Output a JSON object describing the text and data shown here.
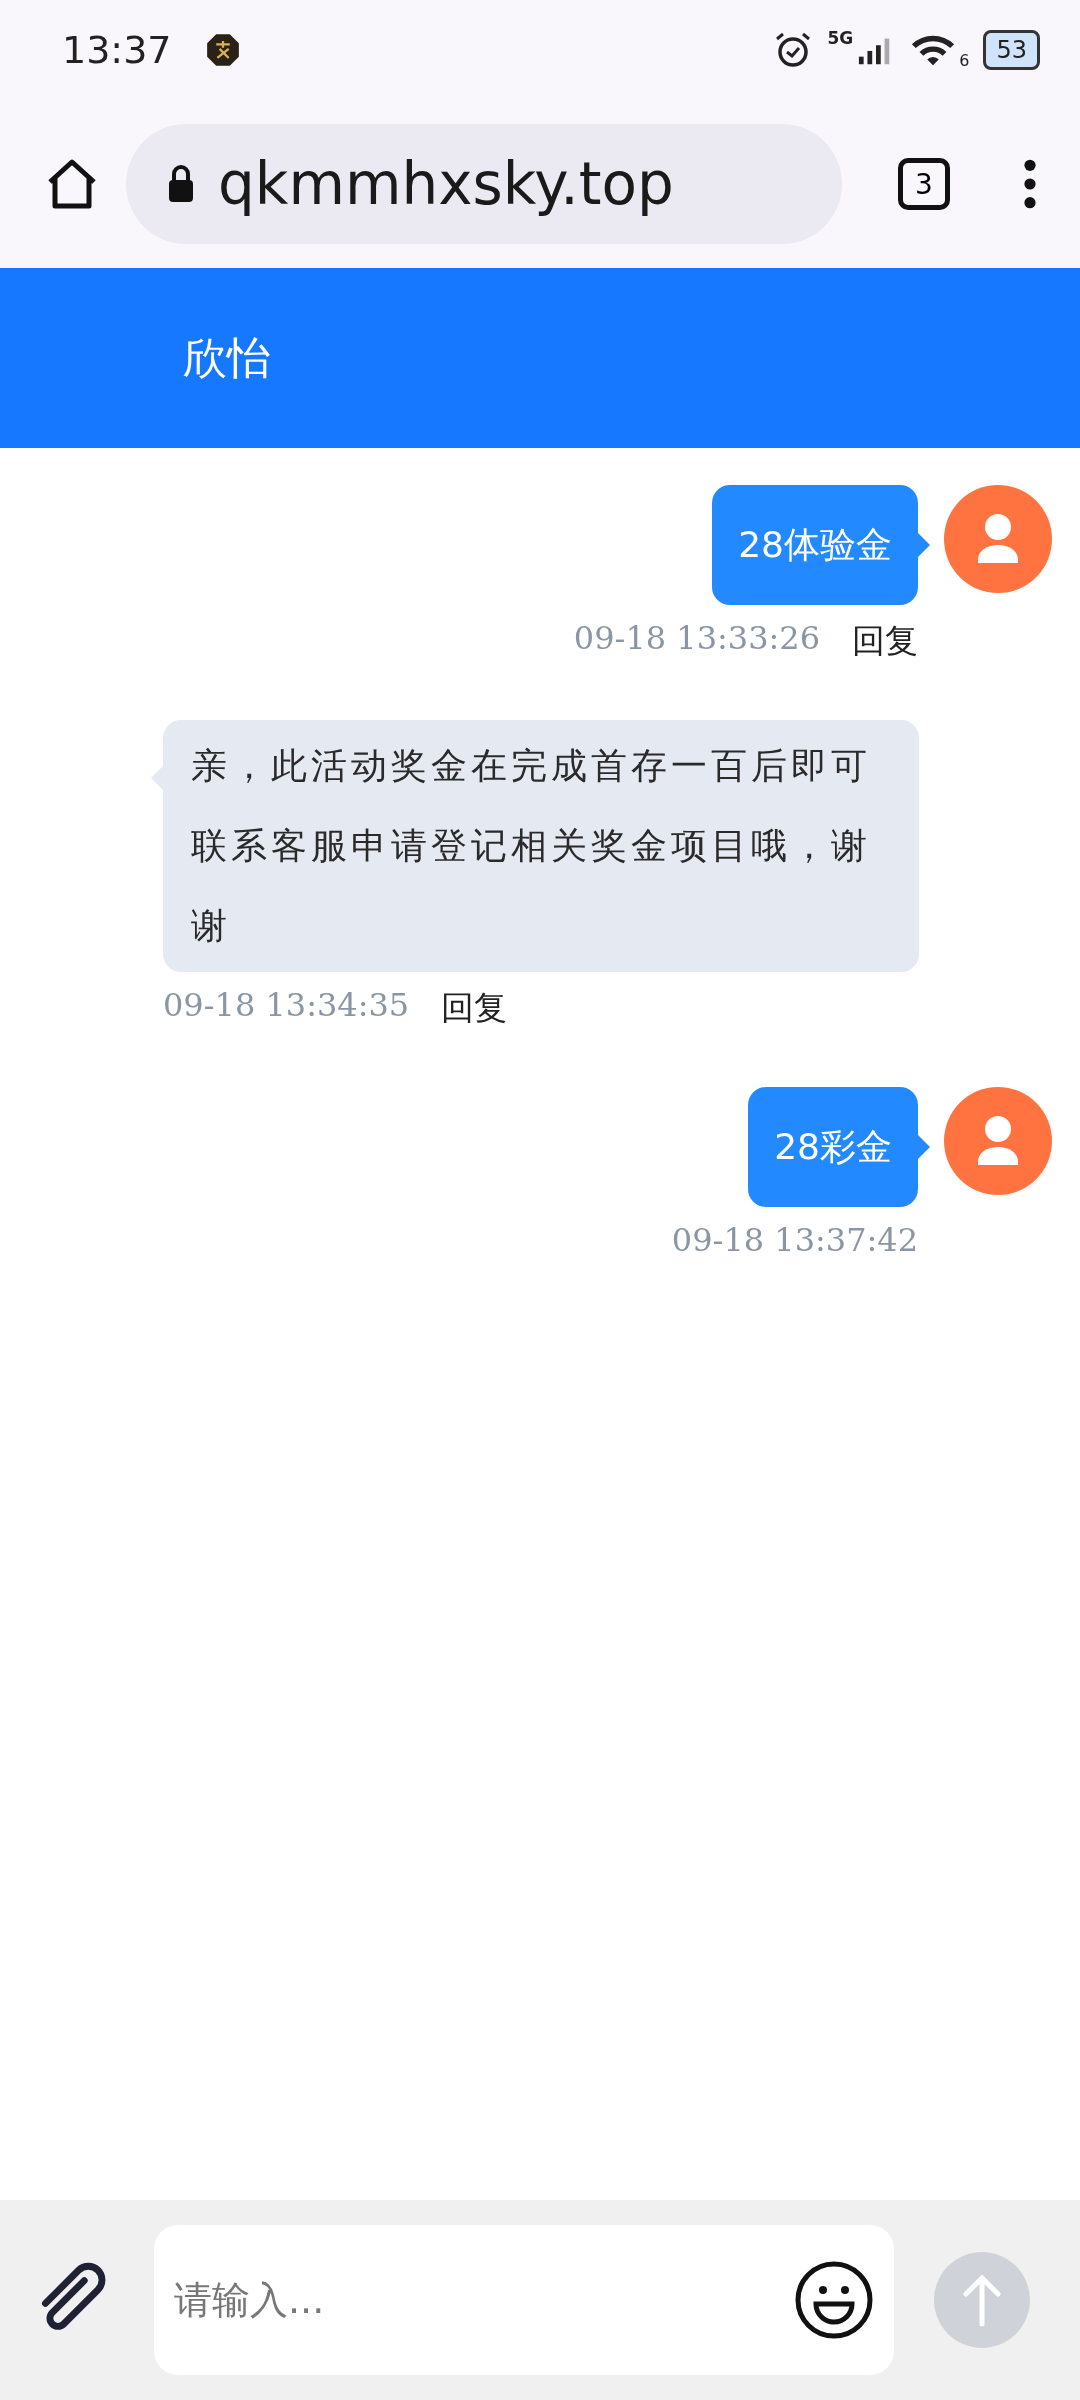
{
  "status_bar": {
    "time": "13:37",
    "network": "5G",
    "wifi_level_label": "6",
    "battery": "53"
  },
  "browser": {
    "url": "qkmmhxsky.top",
    "tab_count": "3"
  },
  "header": {
    "title": "欣怡"
  },
  "messages": [
    {
      "kind": "sent",
      "text": "28体验金",
      "time": "09-18 13:33:26",
      "reply_label": "回复"
    },
    {
      "kind": "received",
      "text": "亲，此活动奖金在完成首存一百后即可联系客服申请登记相关奖金项目哦，谢谢",
      "time": "09-18 13:34:35",
      "reply_label": "回复"
    },
    {
      "kind": "sent",
      "text": "28彩金",
      "time": "09-18 13:37:42"
    }
  ],
  "composer": {
    "placeholder": "请输入..."
  }
}
